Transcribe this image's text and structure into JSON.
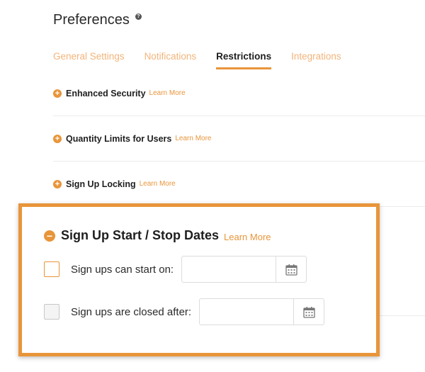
{
  "page": {
    "title": "Preferences",
    "help_icon": "?"
  },
  "tabs": [
    {
      "label": "General Settings",
      "active": false
    },
    {
      "label": "Notifications",
      "active": false
    },
    {
      "label": "Restrictions",
      "active": true
    },
    {
      "label": "Integrations",
      "active": false
    }
  ],
  "sections": [
    {
      "label": "Enhanced Security",
      "learn_more": "Learn More",
      "icon": "plus-circle-icon"
    },
    {
      "label": "Quantity Limits for Users",
      "learn_more": "Learn More",
      "icon": "plus-circle-icon"
    },
    {
      "label": "Sign Up Locking",
      "learn_more": "Learn More",
      "icon": "plus-circle-icon"
    }
  ],
  "expanded": {
    "label": "Sign Up Start / Stop Dates",
    "learn_more": "Learn More",
    "icon": "minus-circle-icon",
    "options": [
      {
        "label": "Sign ups can start on:",
        "value": "",
        "checked": false,
        "highlighted": true
      },
      {
        "label": "Sign ups are closed after:",
        "value": "",
        "checked": false,
        "highlighted": false
      }
    ]
  },
  "colors": {
    "accent": "#e8953a",
    "tab_inactive": "#f2b47a",
    "text": "#1e1e1e",
    "divider": "#ececec"
  }
}
